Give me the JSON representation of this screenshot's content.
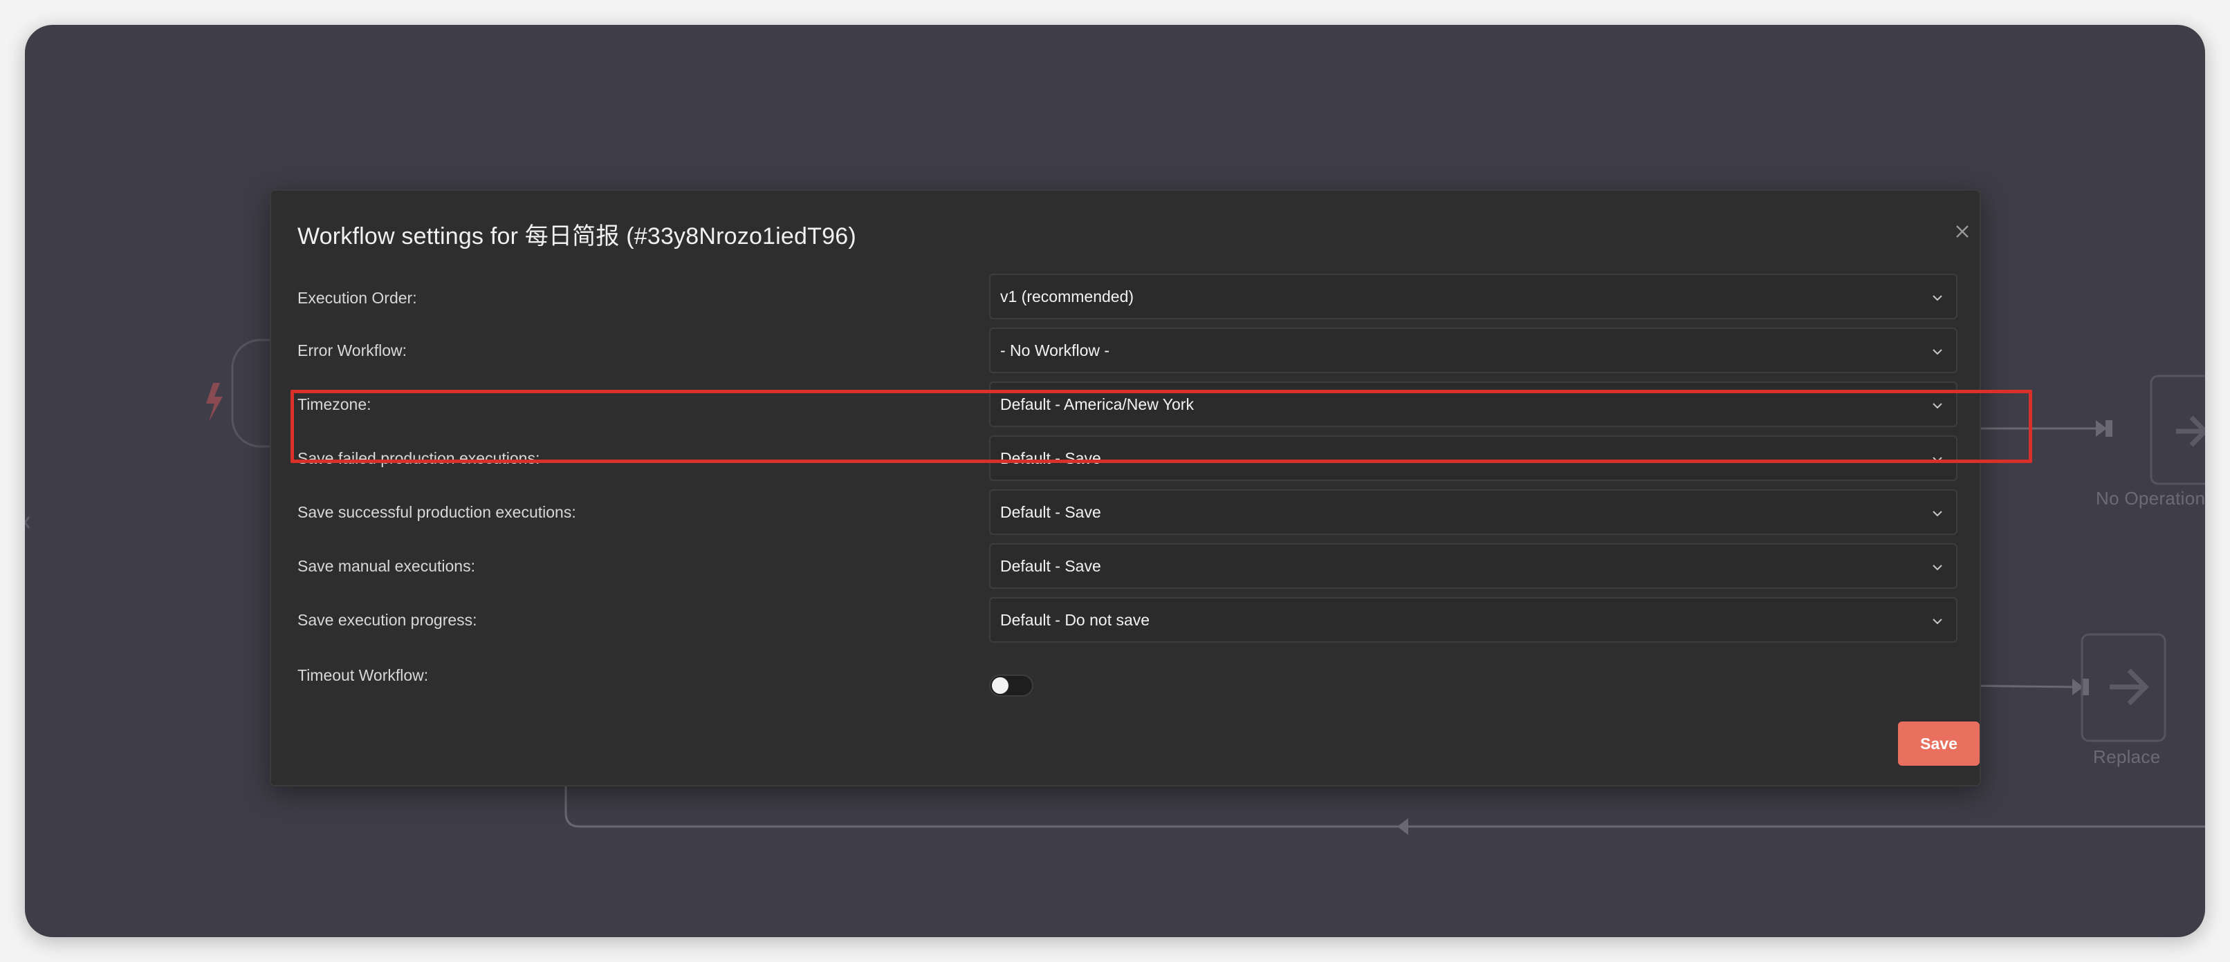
{
  "modal": {
    "title": "Workflow settings for 每日简报 (#33y8Nrozo1iedT96)",
    "save_label": "Save",
    "close_icon": "close-icon",
    "rows": [
      {
        "label": "Execution Order:",
        "value": "v1 (recommended)"
      },
      {
        "label": "Error Workflow:",
        "value": "- No Workflow -"
      },
      {
        "label": "Timezone:",
        "value": "Default - America/New York"
      },
      {
        "label": "Save failed production executions:",
        "value": "Default - Save"
      },
      {
        "label": "Save successful production executions:",
        "value": "Default - Save"
      },
      {
        "label": "Save manual executions:",
        "value": "Default - Save"
      },
      {
        "label": "Save execution progress:",
        "value": "Default - Do not save"
      }
    ],
    "timeout": {
      "label": "Timeout Workflow:",
      "enabled": false
    }
  },
  "canvas": {
    "nodes": [
      {
        "label": "No Operation",
        "icon": "arrow-right-icon"
      },
      {
        "label": "Replace",
        "icon": "arrow-right-icon"
      }
    ]
  },
  "colors": {
    "canvas_bg": "#3f3e48",
    "modal_bg": "#2e2e2e",
    "accent": "#e9705f",
    "highlight": "#d9302a"
  }
}
